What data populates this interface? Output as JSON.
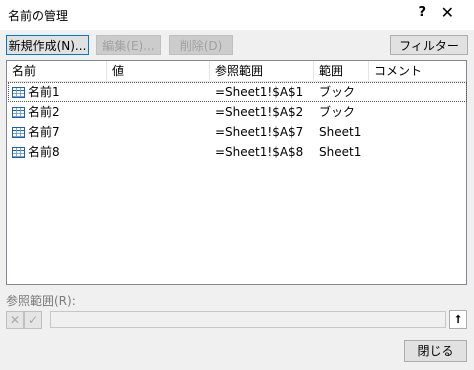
{
  "window": {
    "title": "名前の管理",
    "help_label": "?",
    "close_label": "✕"
  },
  "toolbar": {
    "new_label": "新規作成(N)...",
    "edit_label": "編集(E)...",
    "delete_label": "削除(D)",
    "filter_label": "フィルター(F)",
    "filter_chevron": "▼"
  },
  "table": {
    "columns": [
      "名前",
      "値",
      "参照範囲",
      "範囲",
      "コメント"
    ],
    "rows": [
      {
        "name": "名前1",
        "value": "",
        "ref": "=Sheet1!$A$1",
        "scope": "ブック",
        "comment": ""
      },
      {
        "name": "名前2",
        "value": "",
        "ref": "=Sheet1!$A$2",
        "scope": "ブック",
        "comment": ""
      },
      {
        "name": "名前7",
        "value": "",
        "ref": "=Sheet1!$A$7",
        "scope": "Sheet1",
        "comment": ""
      },
      {
        "name": "名前8",
        "value": "",
        "ref": "=Sheet1!$A$8",
        "scope": "Sheet1",
        "comment": ""
      }
    ]
  },
  "reference": {
    "label": "参照範囲(R):",
    "cancel_glyph": "✕",
    "ok_glyph": "✓",
    "value": "",
    "collapse_glyph": "⭡"
  },
  "footer": {
    "close_label": "閉じる"
  }
}
